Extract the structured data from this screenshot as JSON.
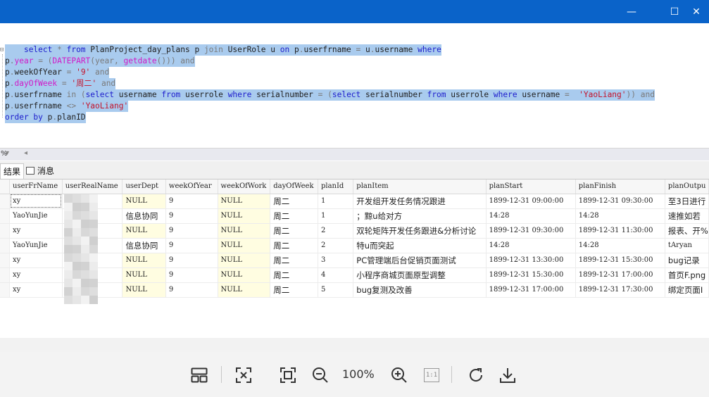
{
  "window": {
    "minimize_glyph": "—",
    "maximize_glyph": "☐",
    "close_glyph": "✕",
    "titlebar_color": "#0a63c9"
  },
  "editor": {
    "selection_color": "#a9cbee",
    "lines": [
      [
        {
          "t": "    ",
          "c": ""
        },
        {
          "t": "select",
          "c": "kw"
        },
        {
          "t": " * ",
          "c": "gray"
        },
        {
          "t": "from",
          "c": "kw"
        },
        {
          "t": " PlanProject_day_plans p ",
          "c": ""
        },
        {
          "t": "join",
          "c": "gray"
        },
        {
          "t": " UserRole u ",
          "c": ""
        },
        {
          "t": "on",
          "c": "kw"
        },
        {
          "t": " p",
          "c": ""
        },
        {
          "t": ".",
          "c": "gray"
        },
        {
          "t": "userfrname ",
          "c": ""
        },
        {
          "t": "=",
          "c": "gray"
        },
        {
          "t": " u",
          "c": ""
        },
        {
          "t": ".",
          "c": "gray"
        },
        {
          "t": "username ",
          "c": ""
        },
        {
          "t": "where",
          "c": "kw"
        }
      ],
      [
        {
          "t": "p",
          "c": ""
        },
        {
          "t": ".",
          "c": "gray"
        },
        {
          "t": "year",
          "c": "fn"
        },
        {
          "t": " = (",
          "c": "gray"
        },
        {
          "t": "DATEPART",
          "c": "fn"
        },
        {
          "t": "(year, ",
          "c": "gray"
        },
        {
          "t": "getdate",
          "c": "fn"
        },
        {
          "t": "())) ",
          "c": "gray"
        },
        {
          "t": "and",
          "c": "gray"
        }
      ],
      [
        {
          "t": "p",
          "c": ""
        },
        {
          "t": ".",
          "c": "gray"
        },
        {
          "t": "weekOfYear ",
          "c": ""
        },
        {
          "t": "= ",
          "c": "gray"
        },
        {
          "t": "'9'",
          "c": "str"
        },
        {
          "t": " ",
          "c": ""
        },
        {
          "t": "and",
          "c": "gray"
        }
      ],
      [
        {
          "t": "p",
          "c": ""
        },
        {
          "t": ".",
          "c": "gray"
        },
        {
          "t": "dayOfWeek",
          "c": "fn"
        },
        {
          "t": " = ",
          "c": "gray"
        },
        {
          "t": "'周二'",
          "c": "str"
        },
        {
          "t": " ",
          "c": ""
        },
        {
          "t": "and",
          "c": "gray"
        }
      ],
      [
        {
          "t": "p",
          "c": ""
        },
        {
          "t": ".",
          "c": "gray"
        },
        {
          "t": "userfrname ",
          "c": ""
        },
        {
          "t": "in",
          "c": "gray"
        },
        {
          "t": " (",
          "c": "gray"
        },
        {
          "t": "select",
          "c": "kw"
        },
        {
          "t": " username ",
          "c": ""
        },
        {
          "t": "from",
          "c": "kw"
        },
        {
          "t": " userrole ",
          "c": ""
        },
        {
          "t": "where",
          "c": "kw"
        },
        {
          "t": " serialnumber ",
          "c": ""
        },
        {
          "t": "= (",
          "c": "gray"
        },
        {
          "t": "select",
          "c": "kw"
        },
        {
          "t": " serialnumber ",
          "c": ""
        },
        {
          "t": "from",
          "c": "kw"
        },
        {
          "t": " userrole ",
          "c": ""
        },
        {
          "t": "where",
          "c": "kw"
        },
        {
          "t": " username ",
          "c": ""
        },
        {
          "t": "=  ",
          "c": "gray"
        },
        {
          "t": "'YaoLiang'",
          "c": "str"
        },
        {
          "t": ")) ",
          "c": "gray"
        },
        {
          "t": "and",
          "c": "gray"
        }
      ],
      [
        {
          "t": "p",
          "c": ""
        },
        {
          "t": ".",
          "c": "gray"
        },
        {
          "t": "userfrname ",
          "c": ""
        },
        {
          "t": "<>",
          "c": "gray"
        },
        {
          "t": " ",
          "c": ""
        },
        {
          "t": "'YaoLiang'",
          "c": "str"
        }
      ],
      [
        {
          "t": "order by",
          "c": "kw"
        },
        {
          "t": " p",
          "c": ""
        },
        {
          "t": ".",
          "c": "gray"
        },
        {
          "t": "planID",
          "c": ""
        }
      ]
    ]
  },
  "scroll": {
    "zoom_fragment": "%"
  },
  "tabs": {
    "results": "结果",
    "messages": "消息"
  },
  "grid": {
    "columns": [
      "userFrName",
      "userRealName",
      "userDept",
      "weekOfYear",
      "weekOfWork",
      "dayOfWeek",
      "planId",
      "planItem",
      "planStart",
      "planFinish",
      "planOutpu"
    ],
    "rows": [
      [
        "xy",
        "",
        "NULL",
        "9",
        "NULL",
        "周二",
        "1",
        "开发组开发任务情况跟进",
        "1899-12-31 09:00:00",
        "1899-12-31 09:30:00",
        "至3日进行"
      ],
      [
        "YaoYunJie",
        "",
        "信息协同",
        "9",
        "NULL",
        "周二",
        "1",
        "；黥u给对方",
        "14:28",
        "14:28",
        "速推如若"
      ],
      [
        "xy",
        "",
        "NULL",
        "9",
        "NULL",
        "周二",
        "2",
        "双轮矩阵开发任务跟进&分析讨论",
        "1899-12-31 09:30:00",
        "1899-12-31 11:30:00",
        "报表、开%"
      ],
      [
        "YaoYunJie",
        "",
        "信息协同",
        "9",
        "NULL",
        "周二",
        "2",
        "特u而突起",
        "14:28",
        "14:28",
        "tAryan"
      ],
      [
        "xy",
        "",
        "NULL",
        "9",
        "NULL",
        "周二",
        "3",
        "PC管理端后台促销页面测试",
        "1899-12-31 13:30:00",
        "1899-12-31 15:30:00",
        "bug记录"
      ],
      [
        "xy",
        "",
        "NULL",
        "9",
        "NULL",
        "周二",
        "4",
        "小程序商城页面原型调整",
        "1899-12-31 15:30:00",
        "1899-12-31 17:00:00",
        "首页F.png"
      ],
      [
        "xy",
        "",
        "NULL",
        "9",
        "NULL",
        "周二",
        "5",
        "bug复测及改善",
        "1899-12-31 17:00:00",
        "1899-12-31 17:30:00",
        "绑定页面I"
      ]
    ],
    "null_cell_color": "#fffde1"
  },
  "toolbar": {
    "zoom": "100%",
    "icons": [
      "layout-icon",
      "fit-selection-icon",
      "fit-window-icon",
      "zoom-out-icon",
      "zoom-in-icon",
      "actual-size-icon",
      "rotate-icon",
      "download-icon"
    ],
    "actual_size_glyph": "1:1"
  }
}
